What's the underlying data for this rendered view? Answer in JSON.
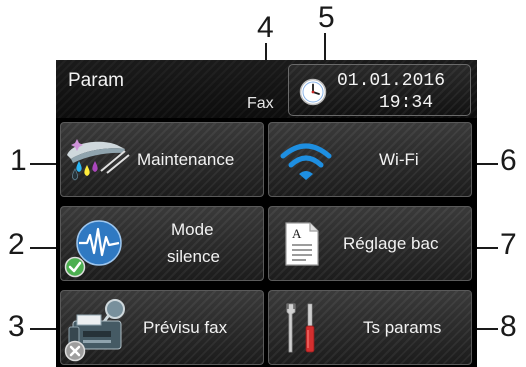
{
  "callouts": {
    "c1": "1",
    "c2": "2",
    "c3": "3",
    "c4": "4",
    "c5": "5",
    "c6": "6",
    "c7": "7",
    "c8": "8"
  },
  "header": {
    "title": "Param",
    "mode_label": "Fax",
    "date": "01.01.2016",
    "time": "19:34"
  },
  "tiles": {
    "maintenance": {
      "label": "Maintenance",
      "icon": "ink-drops-icon"
    },
    "wifi": {
      "label": "Wi-Fi",
      "icon": "wifi-icon"
    },
    "quiet_mode": {
      "label_line1": "Mode",
      "label_line2": "silence",
      "icon": "sound-wave-icon",
      "status": "on"
    },
    "tray_setting": {
      "label": "Réglage bac",
      "icon": "paper-document-icon"
    },
    "fax_preview": {
      "label": "Prévisu fax",
      "icon": "fax-machine-icon",
      "status": "off"
    },
    "all_settings": {
      "label": "Ts params",
      "icon": "tools-icon"
    }
  },
  "colors": {
    "wifi_blue": "#1e8fe1",
    "quiet_blue": "#2f79c2",
    "status_on_green": "#4caf50",
    "status_off_grey": "#9e9e9e"
  }
}
